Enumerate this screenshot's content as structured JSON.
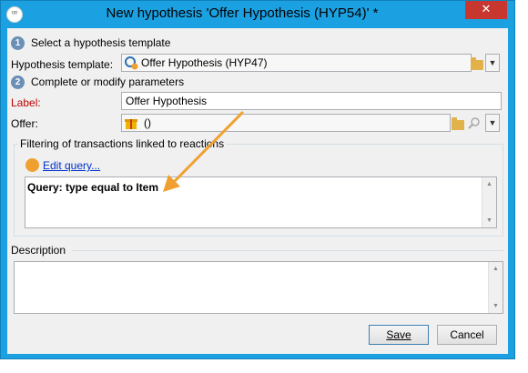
{
  "window": {
    "title": "New hypothesis 'Offer Hypothesis (HYP54)' *",
    "close_glyph": "✕"
  },
  "step1": {
    "number": "1",
    "title": "Select a hypothesis template",
    "template_label": "Hypothesis template:",
    "template_value": "Offer Hypothesis (HYP47)"
  },
  "step2": {
    "number": "2",
    "title": "Complete or modify parameters",
    "label_label": "Label:",
    "label_value": "Offer Hypothesis",
    "offer_label": "Offer:",
    "offer_value": "()"
  },
  "filtering": {
    "title": "Filtering of transactions linked to reactions",
    "edit_query_link": "Edit query...",
    "query_text": "Query: type equal to Item"
  },
  "description": {
    "title": "Description",
    "value": ""
  },
  "buttons": {
    "save": "Save",
    "cancel": "Cancel"
  },
  "colors": {
    "title_bar": "#1ba1e2",
    "close_button": "#c7372f",
    "annotation_arrow": "#f0a030",
    "required_label": "#c00000",
    "link": "#0033cc"
  },
  "icons": {
    "dropdown": "▼",
    "scroll_up": "▲",
    "scroll_down": "▼"
  }
}
